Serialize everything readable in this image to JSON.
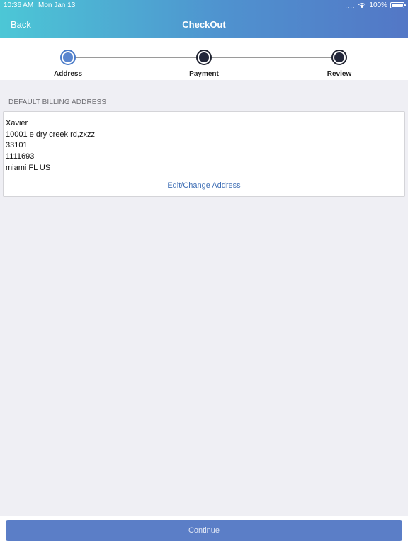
{
  "status_bar": {
    "time": "10:36 AM",
    "date": "Mon Jan 13",
    "signal": "....",
    "battery": "100%",
    "wifi_icon": "wifi-icon",
    "battery_icon": "battery-icon"
  },
  "header": {
    "back_label": "Back",
    "title": "CheckOut"
  },
  "steps": [
    {
      "label": "Address",
      "state": "active"
    },
    {
      "label": "Payment",
      "state": "pending"
    },
    {
      "label": "Review",
      "state": "pending"
    }
  ],
  "billing": {
    "section_title": "DEFAULT BILLING ADDRESS",
    "lines": [
      "Xavier",
      "10001 e dry creek rd,zxzz",
      "33101",
      "1111693",
      "miami FL US"
    ],
    "edit_label": "Edit/Change Address"
  },
  "footer": {
    "continue_label": "Continue"
  },
  "colors": {
    "header_gradient_start": "#4cc7d6",
    "header_gradient_end": "#5377c6",
    "accent": "#5b7ec7",
    "link": "#3f6fb5",
    "background": "#efeff4"
  }
}
